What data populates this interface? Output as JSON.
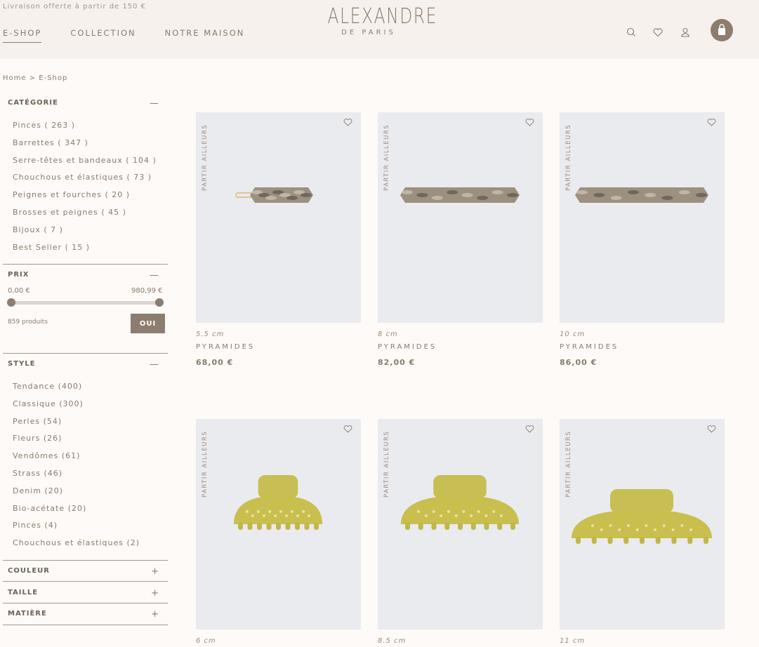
{
  "header": {
    "promo": "Livraison offerte à partir de 150 €",
    "nav": [
      "E-SHOP",
      "COLLECTION",
      "NOTRE MAISON"
    ],
    "logo_main": "ALEXANDRE",
    "logo_sub": "DE PARIS",
    "icons": [
      "search-icon",
      "heart-icon",
      "user-icon",
      "bag-icon"
    ]
  },
  "breadcrumb": "Home  >  E-Shop",
  "filters": {
    "category": {
      "title": "CATÉGORIE",
      "toggle": "—",
      "items": [
        "Pinces  ( 263 )",
        "Barrettes  ( 347 )",
        "Serre-têtes et bandeaux  ( 104 )",
        "Chouchous et élastiques  ( 73 )",
        "Peignes et fourches  ( 20 )",
        "Brosses et peignes  ( 45 )",
        "Bijoux  ( 7 )",
        "Best Seller  ( 15 )"
      ]
    },
    "price": {
      "title": "PRIX",
      "toggle": "—",
      "min": "0,00 €",
      "max": "980,99 €",
      "count": "859 produits",
      "button": "OUI"
    },
    "style": {
      "title": "STYLE",
      "toggle": "—",
      "items": [
        "Tendance  (400)",
        "Classique  (300)",
        "Perles  (54)",
        "Fleurs  (26)",
        "Vendômes  (61)",
        "Strass  (46)",
        "Denim  (20)",
        "Bio-acétate  (20)",
        "Pinces  (4)",
        "Chouchous et élastiques  (2)"
      ]
    },
    "collapsed": [
      {
        "title": "COULEUR",
        "toggle": "+"
      },
      {
        "title": "TAILLE",
        "toggle": "+"
      },
      {
        "title": "MATIÈRE",
        "toggle": "+"
      }
    ]
  },
  "products": [
    {
      "tag": "PARTIR AILLEURS",
      "size": "5.5 cm",
      "name": "PYRAMIDES",
      "price": "68,00 €",
      "kind": "barrette"
    },
    {
      "tag": "PARTIR AILLEURS",
      "size": "8 cm",
      "name": "PYRAMIDES",
      "price": "82,00 €",
      "kind": "barrette"
    },
    {
      "tag": "PARTIR AILLEURS",
      "size": "10 cm",
      "name": "PYRAMIDES",
      "price": "86,00 €",
      "kind": "barrette"
    },
    {
      "tag": "PARTIR AILLEURS",
      "size": "6 cm",
      "name": "",
      "price": "",
      "kind": "clip"
    },
    {
      "tag": "PARTIR AILLEURS",
      "size": "8.5 cm",
      "name": "",
      "price": "",
      "kind": "clip"
    },
    {
      "tag": "PARTIR AILLEURS",
      "size": "11 cm",
      "name": "",
      "price": "",
      "kind": "clip"
    }
  ],
  "colors": {
    "accent": "#8d7d6f",
    "background": "#fdfaf7",
    "header": "#f6f1ec",
    "card": "#eaebef"
  }
}
